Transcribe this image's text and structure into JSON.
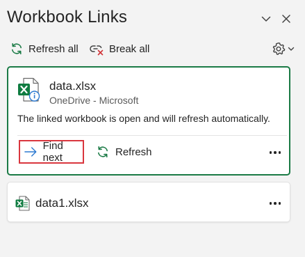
{
  "pane": {
    "title": "Workbook Links",
    "minimize_icon": "chevron-down-icon",
    "close_icon": "close-icon"
  },
  "toolbar": {
    "refresh_all_label": "Refresh all",
    "break_all_label": "Break all",
    "settings_icon": "gear-icon"
  },
  "links": [
    {
      "file_name": "data.xlsx",
      "location": "OneDrive - Microsoft",
      "message": "The linked workbook is open and will refresh automatically.",
      "find_next_label": "Find next",
      "refresh_label": "Refresh",
      "selected": true
    },
    {
      "file_name": "data1.xlsx",
      "selected": false
    }
  ],
  "colors": {
    "accent_green": "#1a7a45",
    "excel_green": "#107c41",
    "highlight_red": "#d9363e",
    "link_blue": "#2b79d0"
  }
}
